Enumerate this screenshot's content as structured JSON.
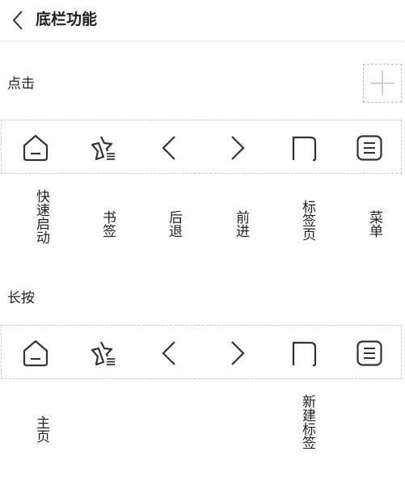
{
  "header": {
    "title": "底栏功能",
    "back_icon": "chevron-left-icon"
  },
  "click_section": {
    "label": "点击",
    "add_icon": "plus-icon",
    "slots": [
      {
        "icon": "home-icon",
        "label": "快速启动"
      },
      {
        "icon": "bookmark-star-icon",
        "label": "书签"
      },
      {
        "icon": "back-arrow-icon",
        "label": "后退"
      },
      {
        "icon": "forward-arrow-icon",
        "label": "前进"
      },
      {
        "icon": "tabs-icon",
        "label": "标签页"
      },
      {
        "icon": "menu-icon",
        "label": "菜单"
      }
    ]
  },
  "long_press_section": {
    "label": "长按",
    "slots": [
      {
        "icon": "home-icon",
        "label": "主页"
      },
      {
        "icon": "bookmark-star-icon",
        "label": ""
      },
      {
        "icon": "back-arrow-icon",
        "label": ""
      },
      {
        "icon": "forward-arrow-icon",
        "label": ""
      },
      {
        "icon": "tabs-icon",
        "label": "新建标签"
      },
      {
        "icon": "menu-icon",
        "label": ""
      }
    ]
  },
  "colors": {
    "icon": "#333333",
    "dashed_border": "#c9c9c9",
    "text": "#222222"
  }
}
